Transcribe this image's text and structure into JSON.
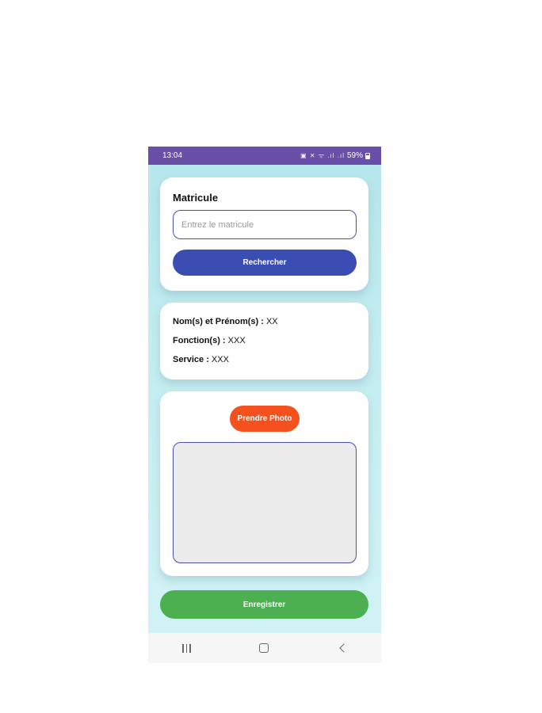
{
  "status_bar": {
    "time": "13:04",
    "icons": "▣ ✕ ᯤ .ıl .ıl",
    "battery": "59%"
  },
  "search_card": {
    "label": "Matricule",
    "input_placeholder": "Entrez le matricule",
    "input_value": "",
    "button_label": "Rechercher"
  },
  "info_card": {
    "name_label": "Nom(s) et Prénom(s) :",
    "name_value": " XX",
    "function_label": "Fonction(s) :",
    "function_value": " XXX",
    "service_label": "Service :",
    "service_value": " XXX"
  },
  "photo_card": {
    "button_label": "Prendre Photo"
  },
  "save_button_label": "Enregistrer",
  "colors": {
    "status_bar": "#6a4fa8",
    "search_button": "#3a4db3",
    "photo_button": "#f4511e",
    "save_button": "#4caf50",
    "input_border": "#4a4fb0"
  },
  "nav_icons": [
    "recent-apps-icon",
    "home-icon",
    "back-icon"
  ]
}
